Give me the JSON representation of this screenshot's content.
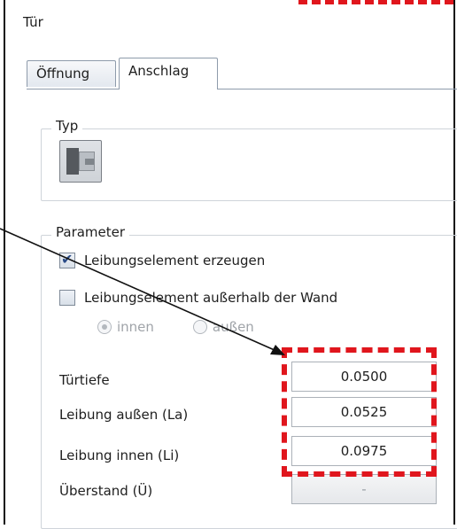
{
  "panel": {
    "title": "Tür"
  },
  "tabs": [
    {
      "label": "Öffnung"
    },
    {
      "label": "Anschlag"
    }
  ],
  "typ": {
    "label": "Typ",
    "icon": "door-type-icon"
  },
  "parameter": {
    "label": "Parameter",
    "leibung_erzeugen": {
      "label": "Leibungselement erzeugen",
      "checked": true
    },
    "leibung_ausserhalb": {
      "label": "Leibungselement außerhalb der Wand",
      "checked": false
    },
    "radios": {
      "innen": "innen",
      "aussen": "außen"
    },
    "fields": {
      "tuertiefe": {
        "label": "Türtiefe",
        "value": "0.0500"
      },
      "leibung_aussen": {
        "label": "Leibung außen (La)",
        "value": "0.0525"
      },
      "leibung_innen": {
        "label": "Leibung innen (Li)",
        "value": "0.0975"
      },
      "ueberstand": {
        "label": "Überstand (Ü)",
        "value": "-"
      }
    }
  },
  "annotation": {
    "highlight_color": "#e0161d"
  }
}
